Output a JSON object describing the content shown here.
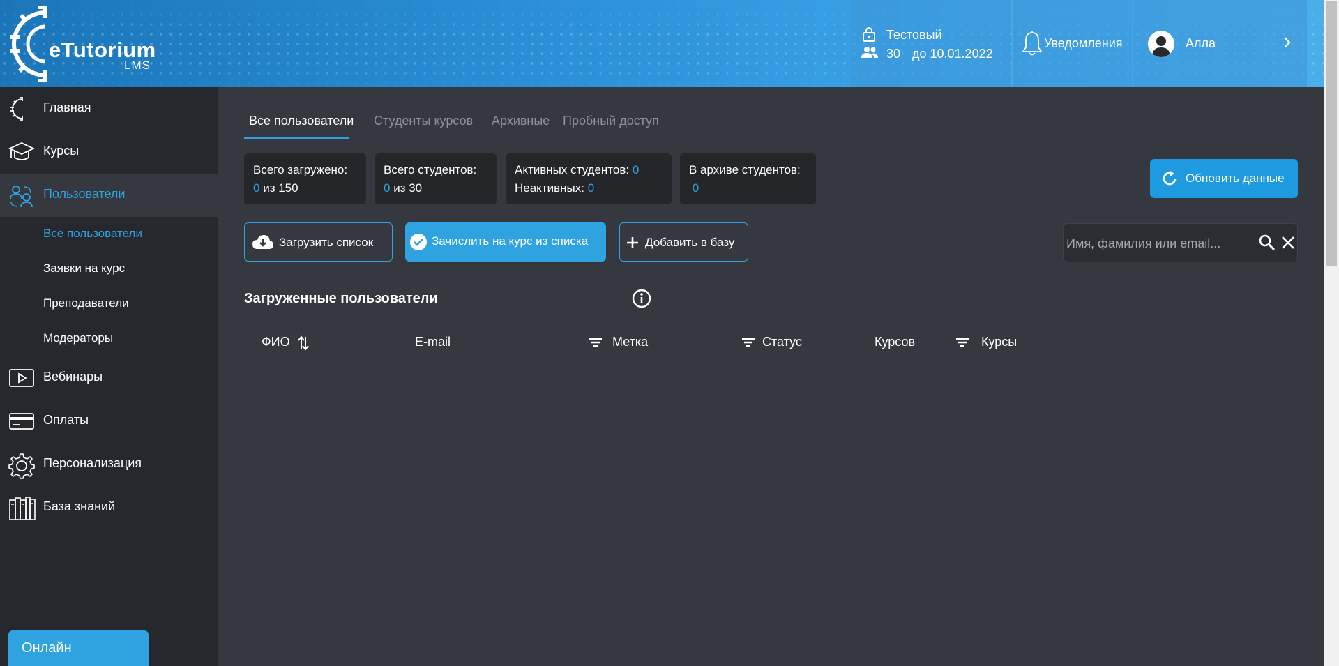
{
  "header": {
    "logo_text": "eTutorium",
    "logo_sub": "LMS",
    "plan_name": "Тестовый",
    "plan_seats": "30",
    "plan_until": "до 10.01.2022",
    "notifications_label": "Уведомления",
    "user_name": "Алла"
  },
  "sidebar": {
    "items": [
      {
        "label": "Главная"
      },
      {
        "label": "Курсы"
      },
      {
        "label": "Пользователи"
      },
      {
        "label": "Вебинары"
      },
      {
        "label": "Оплаты"
      },
      {
        "label": "Персонализация"
      },
      {
        "label": "База знаний"
      }
    ],
    "sub_items": [
      {
        "label": "Все пользователи"
      },
      {
        "label": "Заявки на курс"
      },
      {
        "label": "Преподаватели"
      },
      {
        "label": "Модераторы"
      }
    ],
    "online_label": "Онлайн"
  },
  "tabs": [
    {
      "label": "Все пользователи"
    },
    {
      "label": "Студенты курсов"
    },
    {
      "label": "Архивные"
    },
    {
      "label": "Пробный доступ"
    }
  ],
  "stats": {
    "uploaded_label": "Всего загружено:",
    "uploaded_value": "0",
    "uploaded_of": "из 150",
    "students_label": "Всего студентов:",
    "students_value": "0",
    "students_of": "из 30",
    "active_label": "Активных студентов:",
    "active_value": "0",
    "inactive_label": "Неактивных:",
    "inactive_value": "0",
    "archive_label": "В архиве студентов:",
    "archive_value": "0"
  },
  "actions": {
    "refresh_label": "Обновить данные",
    "upload_label": "Загрузить список",
    "enroll_label": "Зачислить на курс из списка",
    "add_label": "Добавить в базу",
    "search_placeholder": "Имя, фамилия или email..."
  },
  "table": {
    "title": "Загруженные пользователи",
    "columns": [
      {
        "label": "ФИО"
      },
      {
        "label": "E-mail"
      },
      {
        "label": "Метка"
      },
      {
        "label": "Статус"
      },
      {
        "label": "Курсов"
      },
      {
        "label": "Курсы"
      }
    ]
  },
  "colors": {
    "accent": "#2ea3e0",
    "sidebar_bg": "#26282d",
    "main_bg": "#35383e"
  }
}
